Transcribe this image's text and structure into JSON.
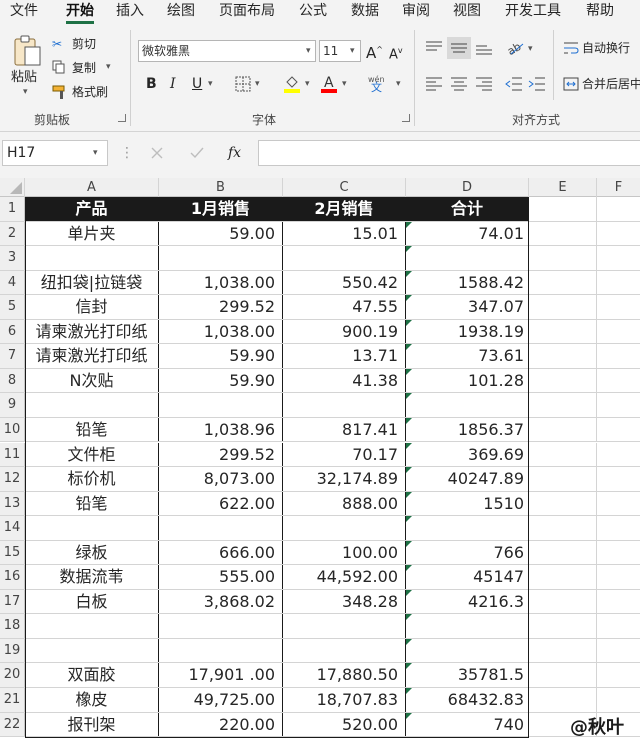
{
  "menu": {
    "tabs": [
      "文件",
      "开始",
      "插入",
      "绘图",
      "页面布局",
      "公式",
      "数据",
      "审阅",
      "视图",
      "开发工具",
      "帮助"
    ],
    "active": "开始"
  },
  "ribbon": {
    "clipboard": {
      "label": "剪贴板",
      "paste": "粘贴",
      "cut": "剪切",
      "copy": "复制",
      "format_painter": "格式刷"
    },
    "font": {
      "label": "字体",
      "font_name": "微软雅黑",
      "font_size": "11",
      "bold": "B",
      "italic": "I",
      "underline": "U",
      "phonetic": "wén"
    },
    "alignment": {
      "label": "对齐方式",
      "wrap_text": "自动换行",
      "merge_center": "合并后居中"
    }
  },
  "formula_bar": {
    "name_box": "H17",
    "fx": "fx",
    "formula": ""
  },
  "columns": [
    "A",
    "B",
    "C",
    "D",
    "E",
    "F"
  ],
  "rows": [
    {
      "n": "1",
      "a": "产品",
      "b": "1月销售",
      "c": "2月销售",
      "d": "合计",
      "header": true
    },
    {
      "n": "2",
      "a": "单片夹",
      "b": "59.00",
      "c": "15.01",
      "d": "74.01"
    },
    {
      "n": "3",
      "a": "",
      "b": "",
      "c": "",
      "d": ""
    },
    {
      "n": "4",
      "a": "纽扣袋|拉链袋",
      "b": "1,038.00",
      "c": "550.42",
      "d": "1588.42"
    },
    {
      "n": "5",
      "a": "信封",
      "b": "299.52",
      "c": "47.55",
      "d": "347.07"
    },
    {
      "n": "6",
      "a": "请柬激光打印纸",
      "b": "1,038.00",
      "c": "900.19",
      "d": "1938.19"
    },
    {
      "n": "7",
      "a": "请柬激光打印纸",
      "b": "59.90",
      "c": "13.71",
      "d": "73.61"
    },
    {
      "n": "8",
      "a": "N次贴",
      "b": "59.90",
      "c": "41.38",
      "d": "101.28"
    },
    {
      "n": "9",
      "a": "",
      "b": "",
      "c": "",
      "d": ""
    },
    {
      "n": "10",
      "a": "铅笔",
      "b": "1,038.96",
      "c": "817.41",
      "d": "1856.37"
    },
    {
      "n": "11",
      "a": "文件柜",
      "b": "299.52",
      "c": "70.17",
      "d": "369.69"
    },
    {
      "n": "12",
      "a": "标价机",
      "b": "8,073.00",
      "c": "32,174.89",
      "d": "40247.89"
    },
    {
      "n": "13",
      "a": "铅笔",
      "b": "622.00",
      "c": "888.00",
      "d": "1510"
    },
    {
      "n": "14",
      "a": "",
      "b": "",
      "c": "",
      "d": ""
    },
    {
      "n": "15",
      "a": "绿板",
      "b": "666.00",
      "c": "100.00",
      "d": "766"
    },
    {
      "n": "16",
      "a": "数据流苇",
      "b": "555.00",
      "c": "44,592.00",
      "d": "45147"
    },
    {
      "n": "17",
      "a": "白板",
      "b": "3,868.02",
      "c": "348.28",
      "d": "4216.3"
    },
    {
      "n": "18",
      "a": "",
      "b": "",
      "c": "",
      "d": ""
    },
    {
      "n": "19",
      "a": "",
      "b": "",
      "c": "",
      "d": ""
    },
    {
      "n": "20",
      "a": "双面胶",
      "b": "17,901 .00",
      "c": "17,880.50",
      "d": "35781.5"
    },
    {
      "n": "21",
      "a": "橡皮",
      "b": "49,725.00",
      "c": "18,707.83",
      "d": "68432.83"
    },
    {
      "n": "22",
      "a": "报刊架",
      "b": "220.00",
      "c": "520.00",
      "d": "740"
    }
  ],
  "watermark": "@秋叶",
  "colors": {
    "accent": "#1e7145",
    "header_fill": "#1a1a1a",
    "header_text": "#ffffff"
  }
}
